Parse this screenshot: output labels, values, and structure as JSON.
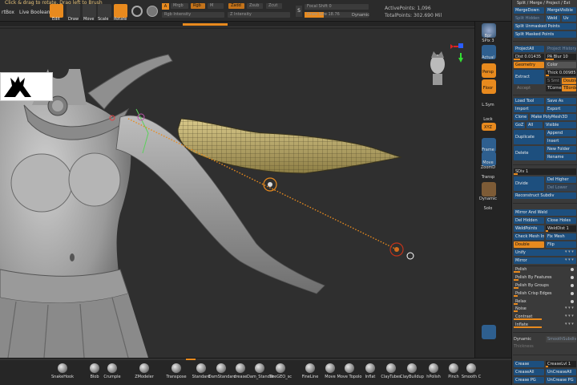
{
  "topbar": {
    "hint": "Click & drag to rotate. Drag left to Brush",
    "left_tab": "rtBox",
    "live_boolean": "Live Boolean",
    "buttons": [
      "Edit",
      "Draw",
      "Move",
      "Scale",
      "Rotate"
    ],
    "a_label": "A",
    "mrgb": "Mrgb",
    "rgb": "Rgb",
    "m": "M",
    "zadd": "Zadd",
    "zsub": "Zsub",
    "zcut": "Zcut",
    "rgb_intensity": "Rgb Intensity",
    "z_intensity": "Z Intensity",
    "s_label": "S",
    "focal_shift": "Focal Shift 0",
    "draw_size": "Draw Size 18.76",
    "dynamic": "Dynamic",
    "active_points": "ActivePoints: 1,096",
    "total_points": "TotalPoints: 302.690 Mil"
  },
  "shelf": {
    "items": [
      {
        "label": "Bpr"
      },
      {
        "label": "SPix 3"
      },
      {
        "label": "Actual"
      },
      {
        "label": "Persp"
      },
      {
        "label": "Floor"
      },
      {
        "label": "L.Sym"
      },
      {
        "label": "Lock"
      },
      {
        "label": "XYZ"
      },
      {
        "label": "Frame"
      },
      {
        "label": "Move"
      },
      {
        "label": "ZoomD"
      },
      {
        "label": "Transp"
      },
      {
        "label": "Dynamic"
      },
      {
        "label": "Solo"
      }
    ]
  },
  "tools": {
    "items": [
      "SnakeHook",
      "Blob",
      "Crumple",
      "ZModeler",
      "Transpose",
      "Standard",
      "DamStandard",
      "crease",
      "Dam_Standar",
      "TheGEO_sc",
      "FineLine",
      "Move",
      "Move Topolo",
      "Inflat",
      "ClayTubes",
      "ClayBuildup",
      "hPolish",
      "Pinch",
      "Smooth C"
    ]
  },
  "panel": {
    "title": "Split / Merge / Project / Ext",
    "merge_down": "MergeDown",
    "merge_visible": "MergeVisible",
    "split_hidden": "Split Hidden",
    "weld": "Weld",
    "uv": "Uv",
    "split_unmasked": "Split Unmasked Points",
    "split_masked": "Split Masked Points",
    "project_all": "ProjectAll",
    "project_history": "Project History",
    "dist": "Dist 0.01435",
    "pa_blur": "PA Blur 10",
    "geometry": "Geometry",
    "color": "Color",
    "extract": "Extract",
    "thick": "Thick 0.00985",
    "smt": "S Smt 5",
    "double": "Double",
    "accept": "Accept",
    "tborder": "TBorder",
    "tcorner": "TCorner",
    "load_tool": "Load Tool",
    "save_as": "Save As",
    "import": "Import",
    "export": "Export",
    "clone": "Clone",
    "make_polymesh": "Make PolyMesh3D",
    "goz": "GoZ",
    "all": "All",
    "visible": "Visible",
    "duplicate": "Duplicate",
    "append": "Append",
    "insert": "Insert",
    "delete": "Delete",
    "new_folder": "New Folder",
    "rename": "Rename",
    "sdiv": "SDiv 1",
    "divide": "Divide",
    "del_higher": "Del Higher",
    "del_lower": "Del Lower",
    "reconstruct": "Reconstruct Subdiv",
    "mirror_weld": "Mirror And Weld",
    "del_hidden": "Del Hidden",
    "close_holes": "Close Holes",
    "weld_points": "WeldPoints",
    "weld_dist": "WeldDist 1",
    "check_mesh": "Check Mesh Int",
    "fix_mesh": "Fix Mesh",
    "double2": "Double",
    "flip": "Flip",
    "unify": "Unify",
    "mirror": "Mirror",
    "polish": "Polish",
    "polish_features": "Polish By Features",
    "polish_groups": "Polish By Groups",
    "polish_crisp": "Polish Crisp Edges",
    "relax": "Relax",
    "noise": "Noise",
    "contrast": "Contrast",
    "inflate": "Inflate",
    "dynamic": "Dynamic",
    "smooth_subdiv": "SmoothSubdiv",
    "thickness": "Thickness",
    "crease": "Crease",
    "crease_lvl": "CreaseLvl 1",
    "crease_all": "CreaseAll",
    "uncrease_all": "UnCreaseAll",
    "crease_pg": "Crease PG",
    "uncrease_pg": "UnCrease PG",
    "stars": "▾ ▾ ▾"
  }
}
